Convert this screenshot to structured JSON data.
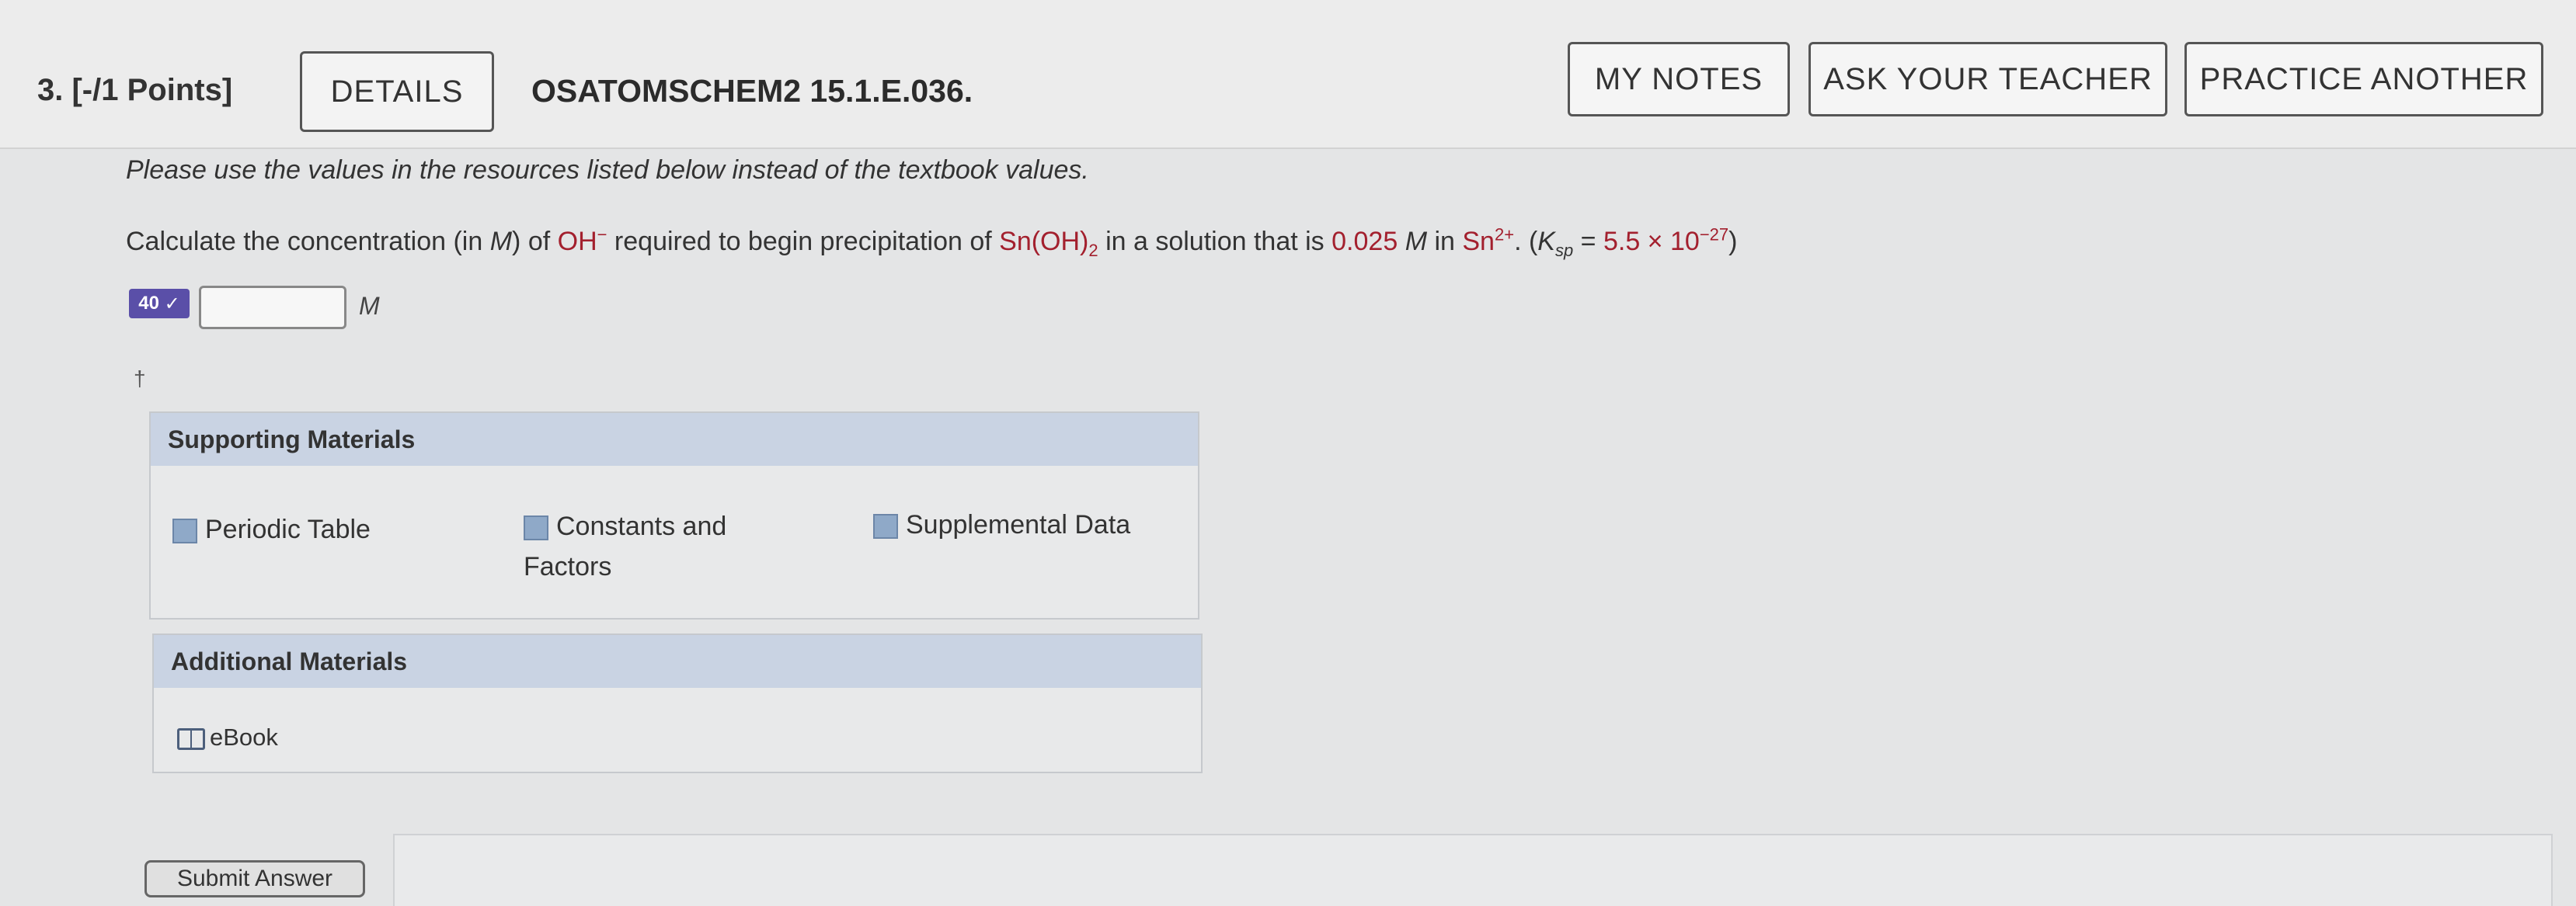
{
  "question": {
    "number_points": "3. [-/1 Points]",
    "details_label": "DETAILS",
    "assignment_id": "OSATOMSCHEM2 15.1.E.036."
  },
  "header_buttons": {
    "my_notes": "MY NOTES",
    "ask_teacher": "ASK YOUR TEACHER",
    "practice_another": "PRACTICE ANOTHER"
  },
  "instruction": "Please use the values in the resources listed below instead of the textbook values.",
  "prompt": {
    "part1": "Calculate the concentration (in ",
    "unit_M": "M",
    "part2": ") of ",
    "ion": "OH",
    "ion_charge": "−",
    "part3": " required to begin precipitation of ",
    "compound": "Sn(OH)",
    "compound_sub": "2",
    "part4": " in a solution that is ",
    "concentration": "0.025",
    "concentration_unit": "M",
    "part5": " in ",
    "cation": "Sn",
    "cation_charge": "2+",
    "part6": ". (",
    "ksp_K": "K",
    "ksp_sub": "sp",
    "ksp_eq": " = ",
    "ksp_value": "5.5 × 10",
    "ksp_exp": "−27",
    "part7": ")"
  },
  "answer": {
    "badge": "40",
    "value": "",
    "unit": "M",
    "dagger": "†"
  },
  "supporting_materials": {
    "title": "Supporting Materials",
    "items": [
      {
        "label": "Periodic Table"
      },
      {
        "label": "Constants and Factors"
      },
      {
        "label": "Supplemental Data"
      }
    ]
  },
  "additional_materials": {
    "title": "Additional Materials",
    "items": [
      {
        "label": "eBook"
      }
    ]
  },
  "submit_label": "Submit Answer",
  "colors": {
    "highlight_red": "#a3202e",
    "panel_header": "#c9d3e3",
    "badge": "#5a4fa8"
  }
}
